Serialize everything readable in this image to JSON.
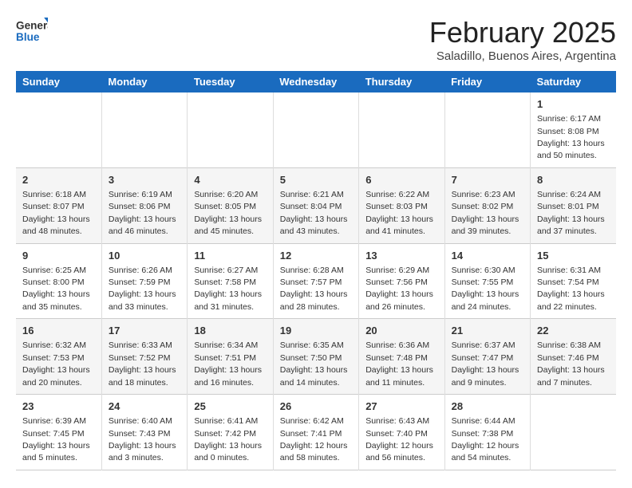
{
  "header": {
    "logo_line1": "General",
    "logo_line2": "Blue",
    "month": "February 2025",
    "location": "Saladillo, Buenos Aires, Argentina"
  },
  "days_of_week": [
    "Sunday",
    "Monday",
    "Tuesday",
    "Wednesday",
    "Thursday",
    "Friday",
    "Saturday"
  ],
  "weeks": [
    [
      {
        "day": "",
        "info": ""
      },
      {
        "day": "",
        "info": ""
      },
      {
        "day": "",
        "info": ""
      },
      {
        "day": "",
        "info": ""
      },
      {
        "day": "",
        "info": ""
      },
      {
        "day": "",
        "info": ""
      },
      {
        "day": "1",
        "info": "Sunrise: 6:17 AM\nSunset: 8:08 PM\nDaylight: 13 hours\nand 50 minutes."
      }
    ],
    [
      {
        "day": "2",
        "info": "Sunrise: 6:18 AM\nSunset: 8:07 PM\nDaylight: 13 hours\nand 48 minutes."
      },
      {
        "day": "3",
        "info": "Sunrise: 6:19 AM\nSunset: 8:06 PM\nDaylight: 13 hours\nand 46 minutes."
      },
      {
        "day": "4",
        "info": "Sunrise: 6:20 AM\nSunset: 8:05 PM\nDaylight: 13 hours\nand 45 minutes."
      },
      {
        "day": "5",
        "info": "Sunrise: 6:21 AM\nSunset: 8:04 PM\nDaylight: 13 hours\nand 43 minutes."
      },
      {
        "day": "6",
        "info": "Sunrise: 6:22 AM\nSunset: 8:03 PM\nDaylight: 13 hours\nand 41 minutes."
      },
      {
        "day": "7",
        "info": "Sunrise: 6:23 AM\nSunset: 8:02 PM\nDaylight: 13 hours\nand 39 minutes."
      },
      {
        "day": "8",
        "info": "Sunrise: 6:24 AM\nSunset: 8:01 PM\nDaylight: 13 hours\nand 37 minutes."
      }
    ],
    [
      {
        "day": "9",
        "info": "Sunrise: 6:25 AM\nSunset: 8:00 PM\nDaylight: 13 hours\nand 35 minutes."
      },
      {
        "day": "10",
        "info": "Sunrise: 6:26 AM\nSunset: 7:59 PM\nDaylight: 13 hours\nand 33 minutes."
      },
      {
        "day": "11",
        "info": "Sunrise: 6:27 AM\nSunset: 7:58 PM\nDaylight: 13 hours\nand 31 minutes."
      },
      {
        "day": "12",
        "info": "Sunrise: 6:28 AM\nSunset: 7:57 PM\nDaylight: 13 hours\nand 28 minutes."
      },
      {
        "day": "13",
        "info": "Sunrise: 6:29 AM\nSunset: 7:56 PM\nDaylight: 13 hours\nand 26 minutes."
      },
      {
        "day": "14",
        "info": "Sunrise: 6:30 AM\nSunset: 7:55 PM\nDaylight: 13 hours\nand 24 minutes."
      },
      {
        "day": "15",
        "info": "Sunrise: 6:31 AM\nSunset: 7:54 PM\nDaylight: 13 hours\nand 22 minutes."
      }
    ],
    [
      {
        "day": "16",
        "info": "Sunrise: 6:32 AM\nSunset: 7:53 PM\nDaylight: 13 hours\nand 20 minutes."
      },
      {
        "day": "17",
        "info": "Sunrise: 6:33 AM\nSunset: 7:52 PM\nDaylight: 13 hours\nand 18 minutes."
      },
      {
        "day": "18",
        "info": "Sunrise: 6:34 AM\nSunset: 7:51 PM\nDaylight: 13 hours\nand 16 minutes."
      },
      {
        "day": "19",
        "info": "Sunrise: 6:35 AM\nSunset: 7:50 PM\nDaylight: 13 hours\nand 14 minutes."
      },
      {
        "day": "20",
        "info": "Sunrise: 6:36 AM\nSunset: 7:48 PM\nDaylight: 13 hours\nand 11 minutes."
      },
      {
        "day": "21",
        "info": "Sunrise: 6:37 AM\nSunset: 7:47 PM\nDaylight: 13 hours\nand 9 minutes."
      },
      {
        "day": "22",
        "info": "Sunrise: 6:38 AM\nSunset: 7:46 PM\nDaylight: 13 hours\nand 7 minutes."
      }
    ],
    [
      {
        "day": "23",
        "info": "Sunrise: 6:39 AM\nSunset: 7:45 PM\nDaylight: 13 hours\nand 5 minutes."
      },
      {
        "day": "24",
        "info": "Sunrise: 6:40 AM\nSunset: 7:43 PM\nDaylight: 13 hours\nand 3 minutes."
      },
      {
        "day": "25",
        "info": "Sunrise: 6:41 AM\nSunset: 7:42 PM\nDaylight: 13 hours\nand 0 minutes."
      },
      {
        "day": "26",
        "info": "Sunrise: 6:42 AM\nSunset: 7:41 PM\nDaylight: 12 hours\nand 58 minutes."
      },
      {
        "day": "27",
        "info": "Sunrise: 6:43 AM\nSunset: 7:40 PM\nDaylight: 12 hours\nand 56 minutes."
      },
      {
        "day": "28",
        "info": "Sunrise: 6:44 AM\nSunset: 7:38 PM\nDaylight: 12 hours\nand 54 minutes."
      },
      {
        "day": "",
        "info": ""
      }
    ]
  ]
}
